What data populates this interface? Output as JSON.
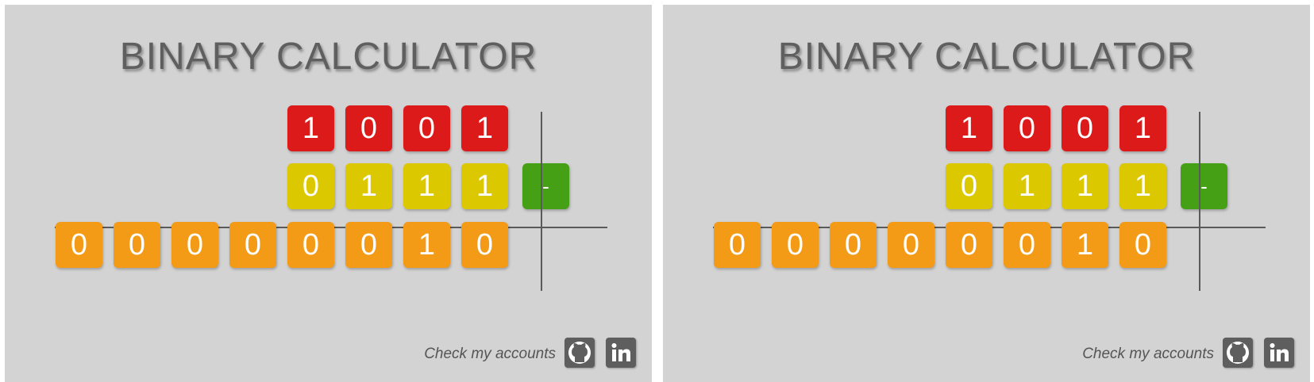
{
  "panels": [
    {
      "title": "BINARY CALCULATOR",
      "row1": [
        "1",
        "0",
        "0",
        "1"
      ],
      "row2": [
        "0",
        "1",
        "1",
        "1"
      ],
      "operator": "-",
      "result": [
        "0",
        "0",
        "0",
        "0",
        "0",
        "0",
        "1",
        "0"
      ],
      "footer_text": "Check my accounts",
      "social": [
        "github-icon",
        "linkedin-icon"
      ]
    },
    {
      "title": "BINARY CALCULATOR",
      "row1": [
        "1",
        "0",
        "0",
        "1"
      ],
      "row2": [
        "0",
        "1",
        "1",
        "1"
      ],
      "operator": "-",
      "result": [
        "0",
        "0",
        "0",
        "0",
        "0",
        "0",
        "1",
        "0"
      ],
      "footer_text": "Check my accounts",
      "social": [
        "github-icon",
        "linkedin-icon"
      ]
    }
  ],
  "colors": {
    "background": "#d3d3d3",
    "title": "#5f5f5f",
    "minuend": "#dc1a1a",
    "subtrahend": "#dcc800",
    "result": "#f39a17",
    "operator": "#45a015",
    "social": "#5e5e5e"
  }
}
